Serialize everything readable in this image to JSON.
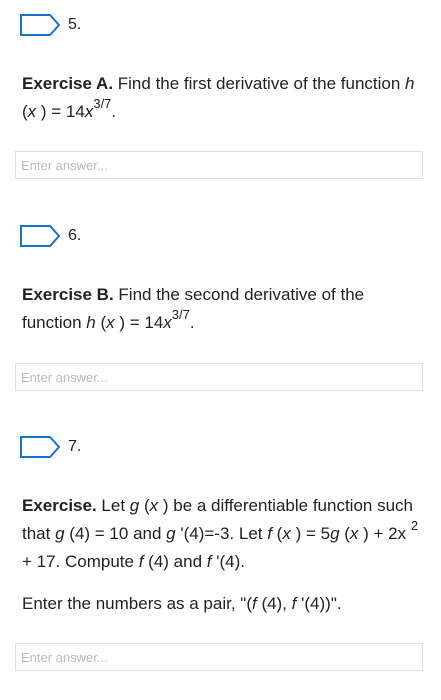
{
  "questions": [
    {
      "number": "5.",
      "title": "Exercise A.",
      "t1": " Find the first derivative of the function ",
      "fn": "h",
      "t2": " (",
      "var": "x",
      "t3": " ) = 14",
      "base": "x",
      "exp": "3/7",
      "t4": ".",
      "placeholder": "Enter answer..."
    },
    {
      "number": "6.",
      "title": "Exercise B.",
      "t1": " Find the second derivative of the function ",
      "fn": "h",
      "t2": " (",
      "var": "x",
      "t3": " ) = 14",
      "base": "x",
      "exp": "3/7",
      "t4": ".",
      "placeholder": "Enter answer..."
    },
    {
      "number": "7.",
      "title": "Exercise.",
      "p": [
        " Let ",
        "g",
        " (",
        "x",
        " ) be a differentiable function such that ",
        "g",
        " (4) = 10 and ",
        "g",
        " '(4)=-3. Let ",
        "f",
        " (",
        "x",
        " ) = 5",
        "g",
        " (",
        "x",
        " ) + 2x ",
        "2",
        " + 17. Compute ",
        "f",
        " (4) and ",
        "f",
        " '(4)."
      ],
      "p2": [
        "Enter the numbers as a pair, \"(",
        "f",
        " (4), ",
        "f",
        " '(4))\"."
      ],
      "placeholder": "Enter answer..."
    }
  ]
}
